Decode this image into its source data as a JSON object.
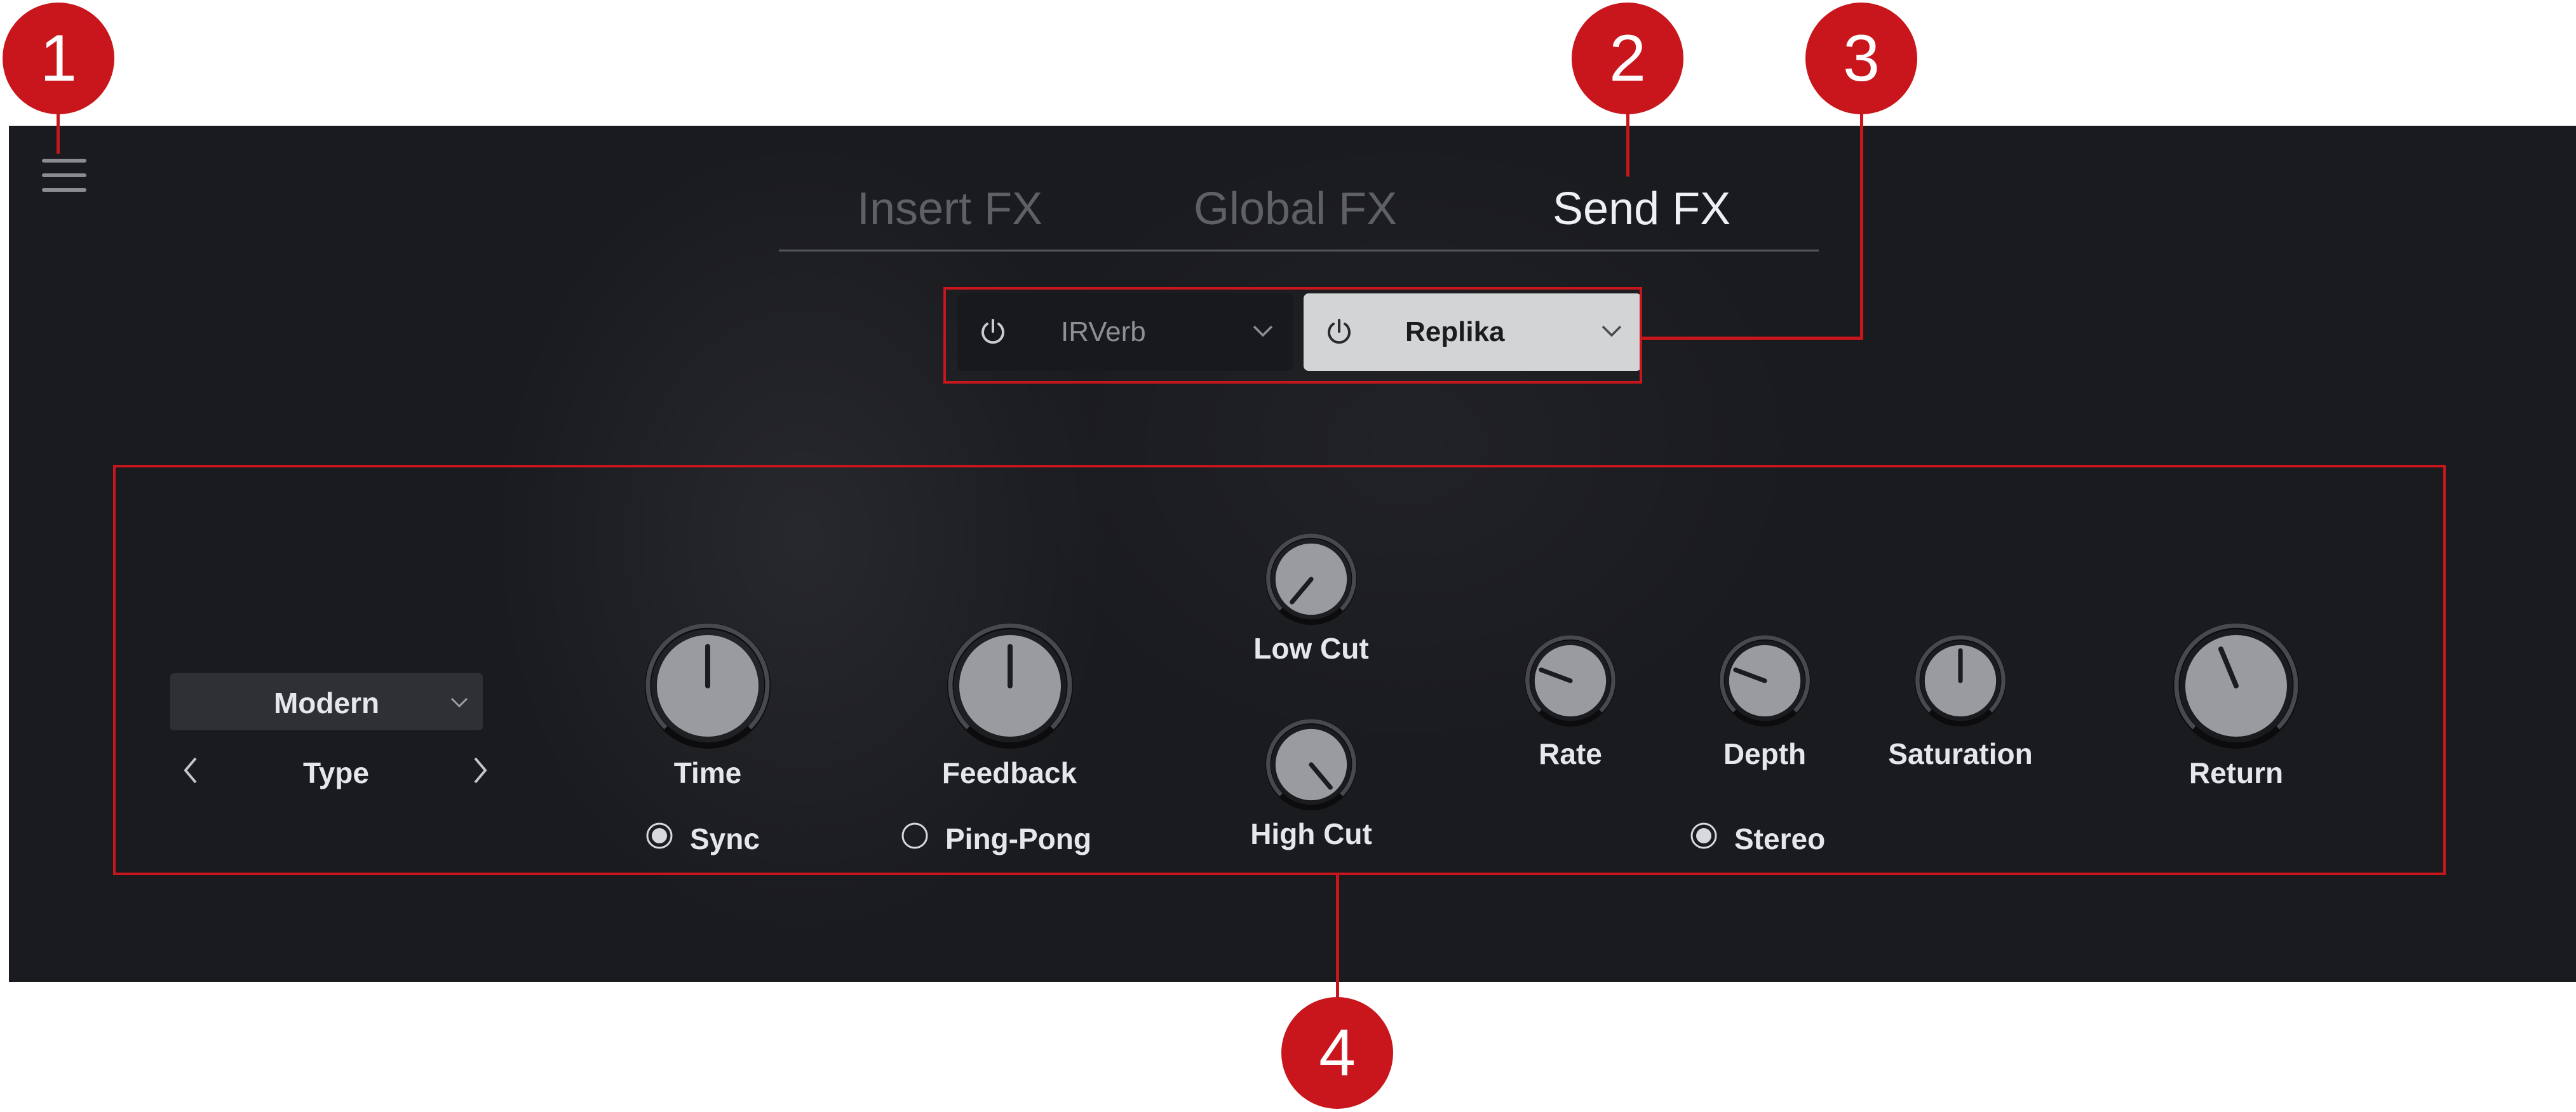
{
  "tabs": [
    {
      "label": "Insert FX",
      "active": false
    },
    {
      "label": "Global FX",
      "active": false
    },
    {
      "label": "Send FX",
      "active": true
    }
  ],
  "fx_slots": [
    {
      "name": "IRVerb",
      "power_icon": "power-icon",
      "chevron_icon": "chevron-down-icon"
    },
    {
      "name": "Replika",
      "power_icon": "power-icon",
      "chevron_icon": "chevron-down-icon"
    }
  ],
  "type_selector": {
    "value": "Modern",
    "label": "Type"
  },
  "knobs": {
    "time": "Time",
    "feedback": "Feedback",
    "low_cut": "Low Cut",
    "high_cut": "High Cut",
    "rate": "Rate",
    "depth": "Depth",
    "saturation": "Saturation",
    "return": "Return"
  },
  "toggles": {
    "sync": {
      "label": "Sync",
      "checked": true
    },
    "ping_pong": {
      "label": "Ping-Pong",
      "checked": false
    },
    "stereo": {
      "label": "Stereo",
      "checked": true
    }
  },
  "callouts": [
    "1",
    "2",
    "3",
    "4"
  ],
  "colors": {
    "accent_red": "#c8161c",
    "panel_bg": "#1a1b1f",
    "active_slot": "#d3d4d6"
  }
}
